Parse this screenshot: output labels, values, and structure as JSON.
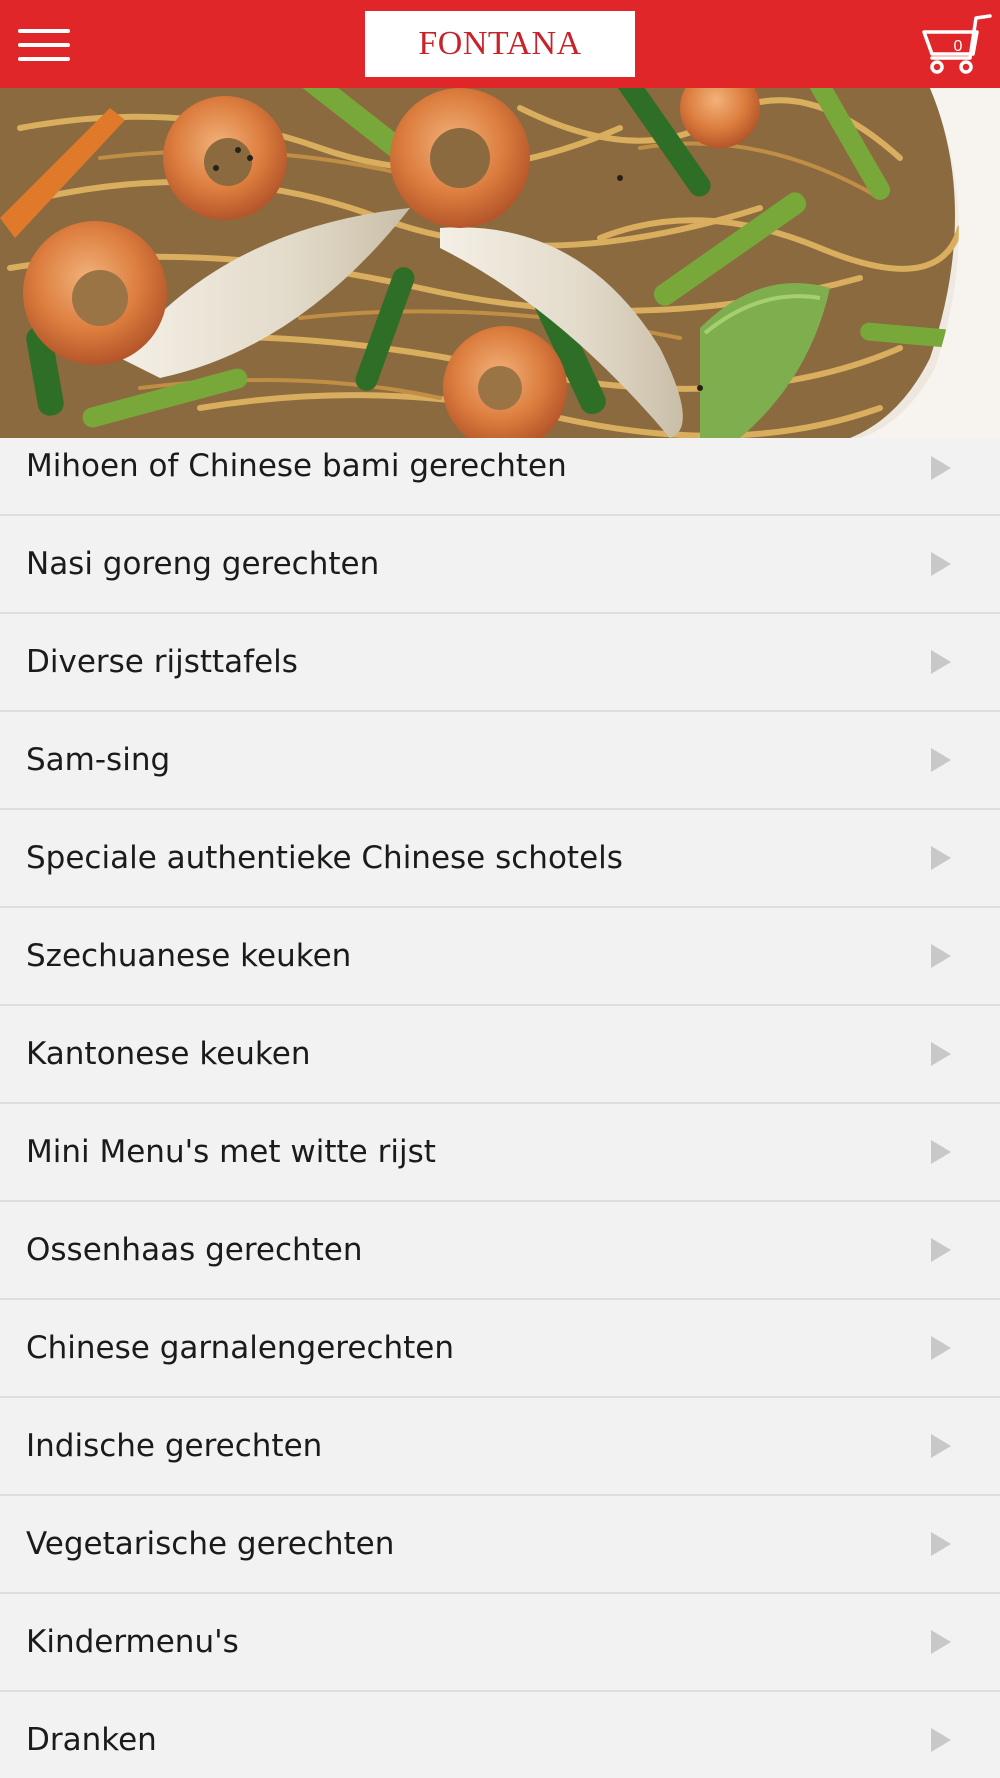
{
  "header": {
    "brand": "FONTANA",
    "cart_count": "0",
    "colors": {
      "bar": "#e1262a",
      "logo_text": "#c7232a"
    }
  },
  "categories": [
    {
      "label": "Mihoen of Chinese bami gerechten"
    },
    {
      "label": "Nasi goreng gerechten"
    },
    {
      "label": "Diverse rijsttafels"
    },
    {
      "label": "Sam-sing"
    },
    {
      "label": "Speciale authentieke Chinese schotels"
    },
    {
      "label": "Szechuanese keuken"
    },
    {
      "label": "Kantonese keuken"
    },
    {
      "label": "Mini Menu's met witte rijst"
    },
    {
      "label": "Ossenhaas gerechten"
    },
    {
      "label": "Chinese garnalengerechten"
    },
    {
      "label": "Indische gerechten"
    },
    {
      "label": "Vegetarische gerechten"
    },
    {
      "label": "Kindermenu's"
    },
    {
      "label": "Dranken"
    }
  ],
  "icons": {
    "menu": "hamburger-menu-icon",
    "cart": "shopping-cart-icon",
    "row_arrow": "chevron-right-icon"
  }
}
